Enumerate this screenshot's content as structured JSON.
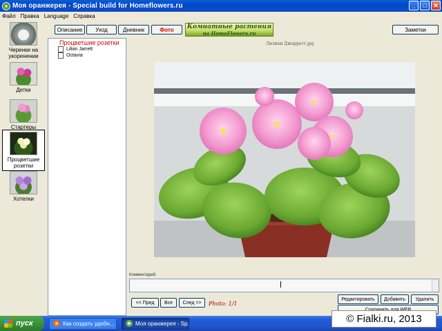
{
  "window": {
    "title": "Моя оранжерея - Special build for Homeflowers.ru",
    "minimize": "_",
    "maximize": "□",
    "close": "✕"
  },
  "menu": [
    "Файл",
    "Правка",
    "Language",
    "Справка"
  ],
  "categories": [
    {
      "label": "Черенки на укоренении"
    },
    {
      "label": "Детки"
    },
    {
      "label": "Стартеры"
    },
    {
      "label": "Процветшие розетки"
    },
    {
      "label": "Хотелки"
    }
  ],
  "toolbar": {
    "description": "Описание",
    "care": "Уход",
    "diary": "Дневник",
    "photo": "Фото",
    "notes": "Заметки"
  },
  "banner": {
    "line1": "Комнатные растения",
    "line2": "на HomeFlowers.ru"
  },
  "tree": {
    "header": "Процветшие розетки",
    "items": [
      "Lilian Jarrett",
      "Octavia"
    ]
  },
  "photo": {
    "caption": "Лилиан Джарретт.jpg",
    "counter": "Photo: 1/1"
  },
  "comment": {
    "label": "Комментарий:"
  },
  "actions": {
    "prev": "<< Пред",
    "all": "Все",
    "next": "След >>",
    "edit": "Редактировать",
    "add": "Добавить",
    "delete": "Удалить",
    "save_web": "Сохранить для WEB"
  },
  "taskbar": {
    "start": "пуск",
    "tasks": [
      "Как создать удобн...",
      "Моя оранжерея - Sp..."
    ]
  },
  "watermark": "© Fialki.ru, 2013"
}
